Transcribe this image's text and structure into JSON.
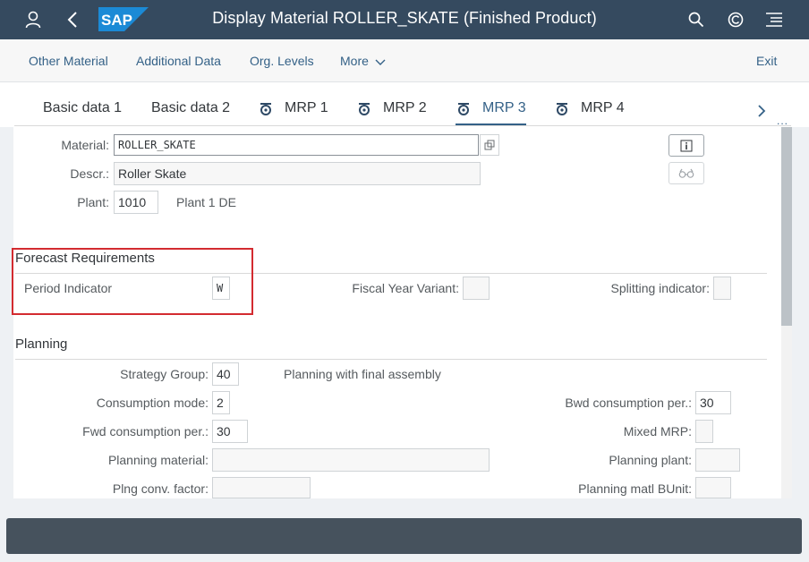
{
  "shell": {
    "title": "Display Material ROLLER_SKATE (Finished Product)",
    "logo_text": "SAP",
    "icons": [
      "user-icon",
      "back-icon",
      "search-icon",
      "copilot-icon",
      "menu-icon"
    ]
  },
  "toolbar": {
    "other_material": "Other Material",
    "additional_data": "Additional Data",
    "org_levels": "Org. Levels",
    "more": "More",
    "exit": "Exit"
  },
  "tabs": {
    "basic1": "Basic data 1",
    "basic2": "Basic data 2",
    "mrp1": "MRP 1",
    "mrp2": "MRP 2",
    "mrp3": "MRP 3",
    "mrp4": "MRP 4",
    "more": "..."
  },
  "header_fields": {
    "material_label": "Material:",
    "material_value": "ROLLER_SKATE",
    "descr_label": "Descr.:",
    "descr_value": "Roller Skate",
    "plant_label": "Plant:",
    "plant_value": "1010",
    "plant_text": "Plant 1 DE"
  },
  "forecast": {
    "title": "Forecast Requirements",
    "period_indicator_label": "Period Indicator",
    "period_indicator_value": "W",
    "fiscal_year_variant_label": "Fiscal Year Variant:",
    "fiscal_year_variant_value": "",
    "splitting_indicator_label": "Splitting indicator:",
    "splitting_indicator_value": ""
  },
  "planning": {
    "title": "Planning",
    "strategy_group_label": "Strategy Group:",
    "strategy_group_value": "40",
    "strategy_group_text": "Planning with final assembly",
    "consumption_mode_label": "Consumption mode:",
    "consumption_mode_value": "2",
    "bwd_consumption_label": "Bwd consumption per.:",
    "bwd_consumption_value": "30",
    "fwd_consumption_label": "Fwd consumption per.:",
    "fwd_consumption_value": "30",
    "mixed_mrp_label": "Mixed MRP:",
    "mixed_mrp_value": "",
    "planning_material_label": "Planning material:",
    "planning_material_value": "",
    "planning_plant_label": "Planning plant:",
    "planning_plant_value": "",
    "plng_conv_factor_label": "Plng conv. factor:",
    "plng_conv_factor_value": "",
    "planning_matl_bunit_label": "Planning matl BUnit:",
    "planning_matl_bunit_value": ""
  },
  "colors": {
    "shell_bg": "#354a5f",
    "link": "#346187",
    "highlight": "#d32b30",
    "footer_bg": "#46525d"
  }
}
